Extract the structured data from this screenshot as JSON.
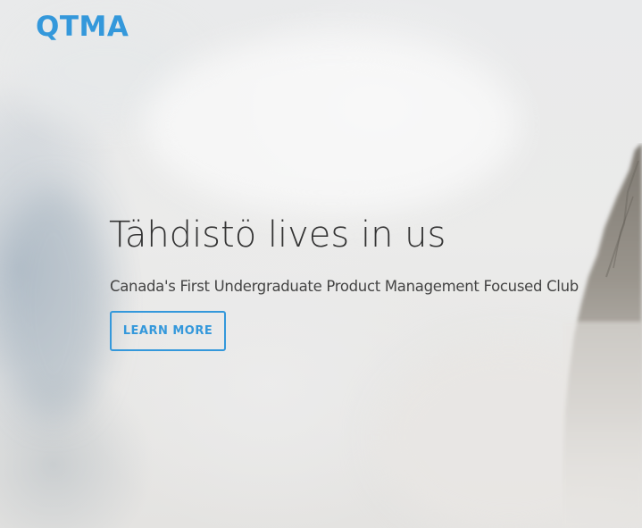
{
  "brand": {
    "name": "QTMA",
    "color": "#3498db"
  },
  "hero": {
    "headline": "Tähdistö lives in us",
    "subheadline": "Canada's First Undergraduate Product Management Focused Club",
    "cta_label": "LEARN MORE",
    "background": "misty-mountain-fog-photo"
  },
  "colors": {
    "accent": "#3498db",
    "headline": "#333333",
    "subheadline": "#444444"
  }
}
